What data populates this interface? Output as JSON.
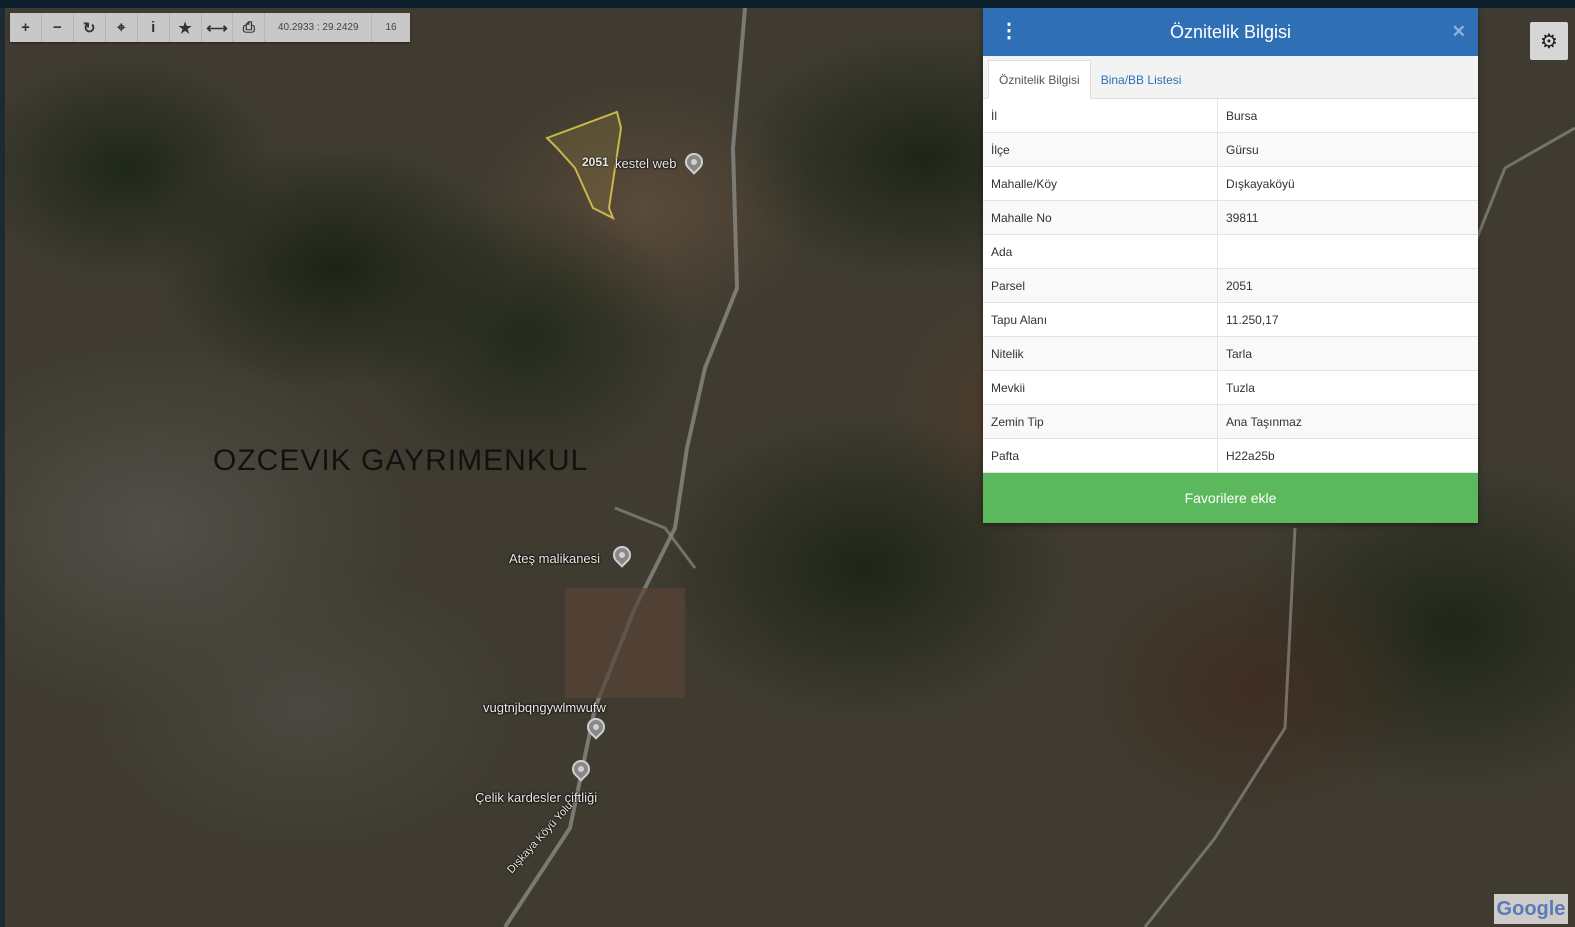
{
  "toolbar": {
    "buttons": [
      {
        "icon": "plus-icon",
        "glyph": "+"
      },
      {
        "icon": "minus-icon",
        "glyph": "−"
      },
      {
        "icon": "refresh-icon",
        "glyph": "↻"
      },
      {
        "icon": "locate-icon",
        "glyph": "⌖"
      },
      {
        "icon": "info-icon",
        "glyph": "i"
      },
      {
        "icon": "star-icon",
        "glyph": "★"
      },
      {
        "icon": "measure-icon",
        "glyph": "⟷"
      },
      {
        "icon": "print-icon",
        "glyph": "⎙"
      }
    ],
    "coordinates": "40.2933 : 29.2429",
    "zoom": "16"
  },
  "map": {
    "watermark": "OZCEVIK GAYRIMENKUL",
    "parcel_label": "2051",
    "places": [
      "kestel web",
      "Ateş malikanesi",
      "vugtnjbqngywlmwufw",
      "Çelik kardesler çiftliği",
      "Dışkaya Köyü Yolu"
    ],
    "attribution": "Google"
  },
  "panel": {
    "title": "Öznitelik Bilgisi",
    "tabs": [
      "Öznitelik Bilgisi",
      "Bina/BB Listesi"
    ],
    "rows": [
      {
        "key": "İl",
        "value": "Bursa"
      },
      {
        "key": "İlçe",
        "value": "Gürsu"
      },
      {
        "key": "Mahalle/Köy",
        "value": "Dışkayaköyü"
      },
      {
        "key": "Mahalle No",
        "value": "39811"
      },
      {
        "key": "Ada",
        "value": ""
      },
      {
        "key": "Parsel",
        "value": "2051"
      },
      {
        "key": "Tapu Alanı",
        "value": "11.250,17"
      },
      {
        "key": "Nitelik",
        "value": "Tarla"
      },
      {
        "key": "Mevkii",
        "value": "Tuzla"
      },
      {
        "key": "Zemin Tip",
        "value": "Ana Taşınmaz"
      },
      {
        "key": "Pafta",
        "value": "H22a25b"
      }
    ],
    "favorite_button": "Favorilere ekle"
  },
  "colors": {
    "panel_header": "#2f6fb5",
    "favorite_button": "#5cb85c",
    "parcel_outline": "#c8b84a"
  }
}
